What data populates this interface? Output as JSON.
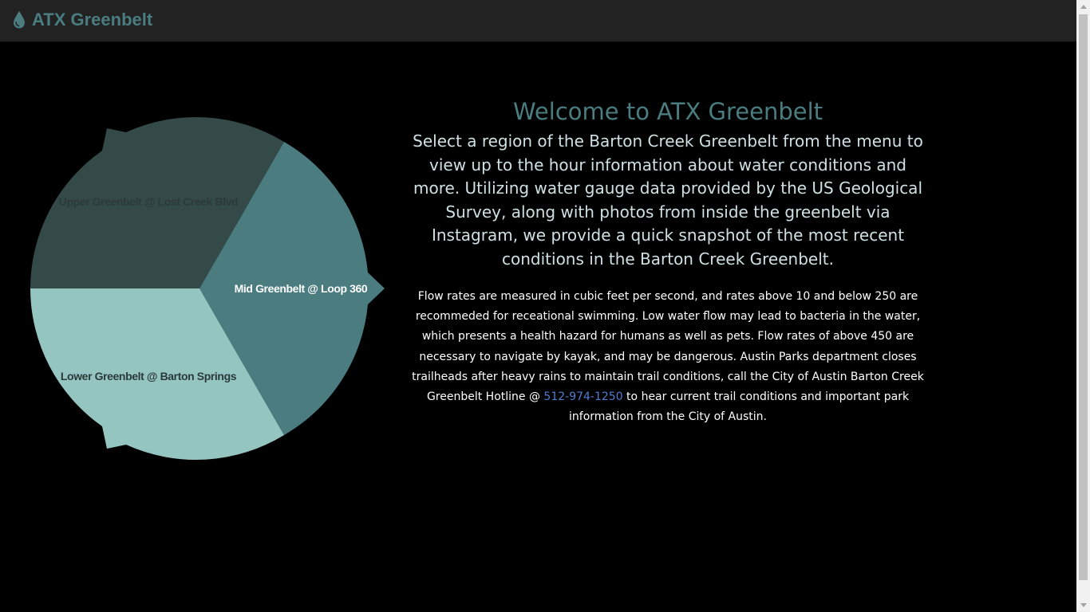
{
  "app": {
    "title": "ATX Greenbelt"
  },
  "menu": {
    "items": [
      {
        "label": "Upper Greenbelt @ Lost Creek Blvd"
      },
      {
        "label": "Mid Greenbelt @ Loop 360"
      },
      {
        "label": "Lower Greenbelt @ Barton Springs"
      }
    ]
  },
  "main": {
    "heading": "Welcome to ATX Greenbelt",
    "intro": "Select a region of the Barton Creek Greenbelt from the menu to view up to the hour information about water conditions and more. Utilizing water gauge data provided by the US Geological Survey, along with photos from inside the greenbelt via Instagram, we provide a quick snapshot of the most recent conditions in the Barton Creek Greenbelt.",
    "details_before": "Flow rates are measured in cubic feet per second, and rates above 10 and below 250 are recommeded for receational swimming. Low water flow may lead to bacteria in the water, which presents a health hazard for humans as well as pets. Flow rates of above 450 are necessary to navigate by kayak, and may be dangerous. Austin Parks department closes trailheads after heavy rains to maintain trail conditions, call the City of Austin Barton Creek Greenbelt Hotline @ ",
    "hotline": "512-974-1250",
    "details_after": " to hear current trail conditions and important park information from the City of Austin."
  },
  "colors": {
    "brand": "#4a7c80",
    "upper": "#344a48",
    "mid": "#4a7c80",
    "lower": "#94c5c1",
    "link": "#4f7ccf"
  },
  "icons": {
    "brand": "water-drop-icon"
  }
}
